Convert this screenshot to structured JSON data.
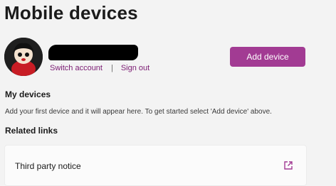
{
  "page": {
    "title": "Mobile devices"
  },
  "account": {
    "switch_label": "Switch account",
    "separator": "|",
    "signout_label": "Sign out"
  },
  "actions": {
    "add_device_label": "Add device"
  },
  "my_devices": {
    "heading": "My devices",
    "empty_hint": "Add your first device and it will appear here. To get started select 'Add device' above."
  },
  "related": {
    "heading": "Related links",
    "items": [
      {
        "label": "Third party notice",
        "icon": "external-link-icon"
      }
    ]
  },
  "colors": {
    "accent": "#a23b93",
    "link": "#7a1a72",
    "background": "#f3f3f3"
  }
}
